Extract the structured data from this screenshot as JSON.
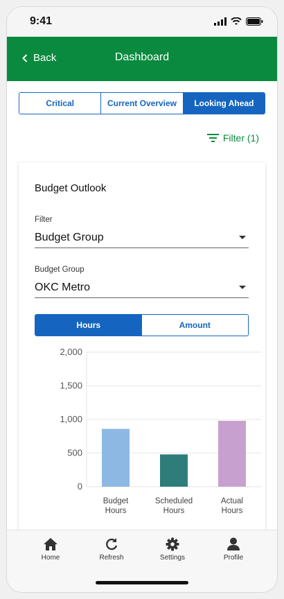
{
  "status_bar": {
    "time": "9:41"
  },
  "header": {
    "back_label": "Back",
    "title": "Dashboard"
  },
  "tabs": [
    {
      "label": "Critical",
      "active": false
    },
    {
      "label": "Current Overview",
      "active": false
    },
    {
      "label": "Looking Ahead",
      "active": true
    }
  ],
  "filter_link": {
    "label": "Filter (1)"
  },
  "card": {
    "title": "Budget Outlook",
    "filter": {
      "label": "Filter",
      "value": "Budget Group"
    },
    "budget_group": {
      "label": "Budget Group",
      "value": "OKC Metro"
    },
    "toggle": {
      "hours_label": "Hours",
      "amount_label": "Amount",
      "selected": "Hours"
    }
  },
  "chart_data": {
    "type": "bar",
    "categories": [
      "Budget Hours",
      "Scheduled Hours",
      "Actual Hours"
    ],
    "category_lines": [
      [
        "Budget",
        "Hours"
      ],
      [
        "Scheduled",
        "Hours"
      ],
      [
        "Actual",
        "Hours"
      ]
    ],
    "values": [
      860,
      480,
      980
    ],
    "colors": [
      "#8db8e4",
      "#2e7d7a",
      "#c8a0cf"
    ],
    "ylim": [
      0,
      2000
    ],
    "yticks": [
      0,
      500,
      1000,
      1500,
      2000
    ],
    "ytick_labels": [
      "0",
      "500",
      "1,000",
      "1,500",
      "2,000"
    ],
    "grid": true
  },
  "bottom_nav": [
    {
      "label": "Home",
      "icon": "home-icon"
    },
    {
      "label": "Refresh",
      "icon": "refresh-icon"
    },
    {
      "label": "Settings",
      "icon": "settings-icon"
    },
    {
      "label": "Profile",
      "icon": "profile-icon"
    }
  ],
  "colors": {
    "brand_green": "#0a8a3e",
    "accent_blue": "#1565c0"
  }
}
